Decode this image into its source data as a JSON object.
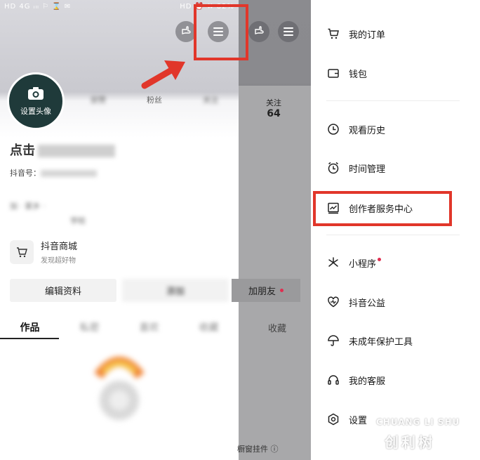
{
  "left_phone": {
    "status_bar": {
      "left": "HD 4G ᵢₗₗ ⚐ ⌛ ✉",
      "right": "HD ⏰ ✖ 82%"
    },
    "avatar_label": "设置头像",
    "stats": [
      {
        "label": "获赞",
        "value": ""
      },
      {
        "label": "粉丝",
        "value": ""
      },
      {
        "label": "关注",
        "value": ""
      }
    ],
    "name_prefix": "点击",
    "id_prefix": "抖音号：",
    "info_line1": "加 · 家乡 · ",
    "info_line2": "学校",
    "shop_title": "抖音商城",
    "shop_sub": "发现超好物",
    "edit_button": "编辑资料",
    "second_button": "添加",
    "tabs": [
      "作品",
      "私密",
      "喜欢",
      "收藏"
    ]
  },
  "middle": {
    "follow_label": "关注",
    "follow_value": "64",
    "add_friend": "加朋友",
    "collect": "收藏",
    "widget": "橱窗挂件 ⓘ"
  },
  "drawer": {
    "items": [
      {
        "label": "我的订单",
        "icon": "cart-icon"
      },
      {
        "label": "钱包",
        "icon": "wallet-icon"
      },
      {
        "label": "观看历史",
        "icon": "clock-icon"
      },
      {
        "label": "时间管理",
        "icon": "alarm-icon"
      },
      {
        "label": "创作者服务中心",
        "icon": "chart-icon"
      },
      {
        "label": "小程序",
        "icon": "asterisk-icon"
      },
      {
        "label": "抖音公益",
        "icon": "heart-icon"
      },
      {
        "label": "未成年保护工具",
        "icon": "umbrella-icon"
      },
      {
        "label": "我的客服",
        "icon": "headset-icon"
      },
      {
        "label": "设置",
        "icon": "gear-icon"
      }
    ]
  },
  "watermark": {
    "english": "CHUANG LI SHU",
    "chinese": "创利树"
  },
  "colors": {
    "highlight": "#e1362a",
    "notification_dot": "#e02e50",
    "avatar_bg": "#1f3a3a"
  }
}
